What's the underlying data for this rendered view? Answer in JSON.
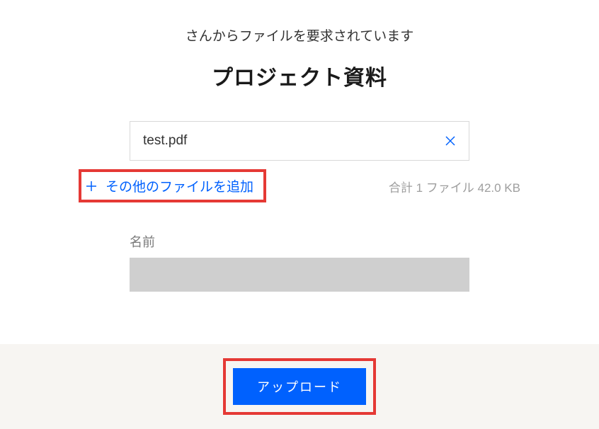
{
  "header": {
    "subtitle": "さんからファイルを要求されています",
    "title": "プロジェクト資料"
  },
  "file": {
    "name": "test.pdf"
  },
  "add_more": {
    "label": "その他のファイルを追加"
  },
  "summary": {
    "text": "合計 1 ファイル 42.0 KB"
  },
  "name_field": {
    "label": "名前",
    "value": ""
  },
  "footer": {
    "upload_label": "アップロード"
  }
}
